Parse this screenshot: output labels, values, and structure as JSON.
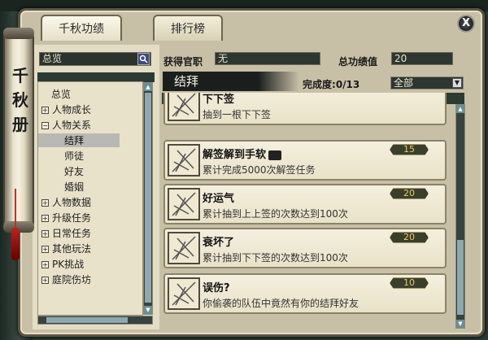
{
  "window": {
    "close_label": "X"
  },
  "scroll_title": "千秋册",
  "tabs": [
    {
      "label": "千秋功绩",
      "active": true
    },
    {
      "label": "排行榜",
      "active": false
    }
  ],
  "search": {
    "value": "总览"
  },
  "tree": [
    {
      "label": "总览",
      "type": "root"
    },
    {
      "label": "人物成长",
      "type": "group"
    },
    {
      "label": "人物关系",
      "type": "group-open"
    },
    {
      "label": "结拜",
      "type": "child",
      "selected": true
    },
    {
      "label": "师徒",
      "type": "child"
    },
    {
      "label": "好友",
      "type": "child"
    },
    {
      "label": "婚姻",
      "type": "child"
    },
    {
      "label": "人物数据",
      "type": "group"
    },
    {
      "label": "升级任务",
      "type": "group"
    },
    {
      "label": "日常任务",
      "type": "group"
    },
    {
      "label": "其他玩法",
      "type": "group"
    },
    {
      "label": "PK挑战",
      "type": "group"
    },
    {
      "label": "庭院伤坊",
      "type": "group"
    }
  ],
  "header": {
    "title_label": "获得官职",
    "title_value": "无",
    "score_label": "总功绩值",
    "score_value": "20"
  },
  "category": {
    "name": "结拜",
    "progress_label": "完成度:",
    "progress_text": "0/13",
    "filter_value": "全部"
  },
  "achievements": [
    {
      "title": "下下签",
      "desc": "抽到一根下下签",
      "points": "",
      "partial": true
    },
    {
      "title": "解签解到手软",
      "desc": "累计完成5000次解签任务",
      "points": "15",
      "has_book": true
    },
    {
      "title": "好运气",
      "desc": "累计抽到上上签的次数达到100次",
      "points": "20"
    },
    {
      "title": "衰坏了",
      "desc": "累计抽到下下签的次数达到100次",
      "points": "20"
    },
    {
      "title": "误伤?",
      "desc": "你偷袭的队伍中竟然有你的结拜好友",
      "points": "10"
    }
  ],
  "icons": {
    "close": "close-icon",
    "search": "search-icon",
    "dropdown": "chevron-down-icon",
    "achievement": "bamboo-icon"
  },
  "colors": {
    "gold": "#e9c869",
    "panel": "#e4ddc5"
  }
}
